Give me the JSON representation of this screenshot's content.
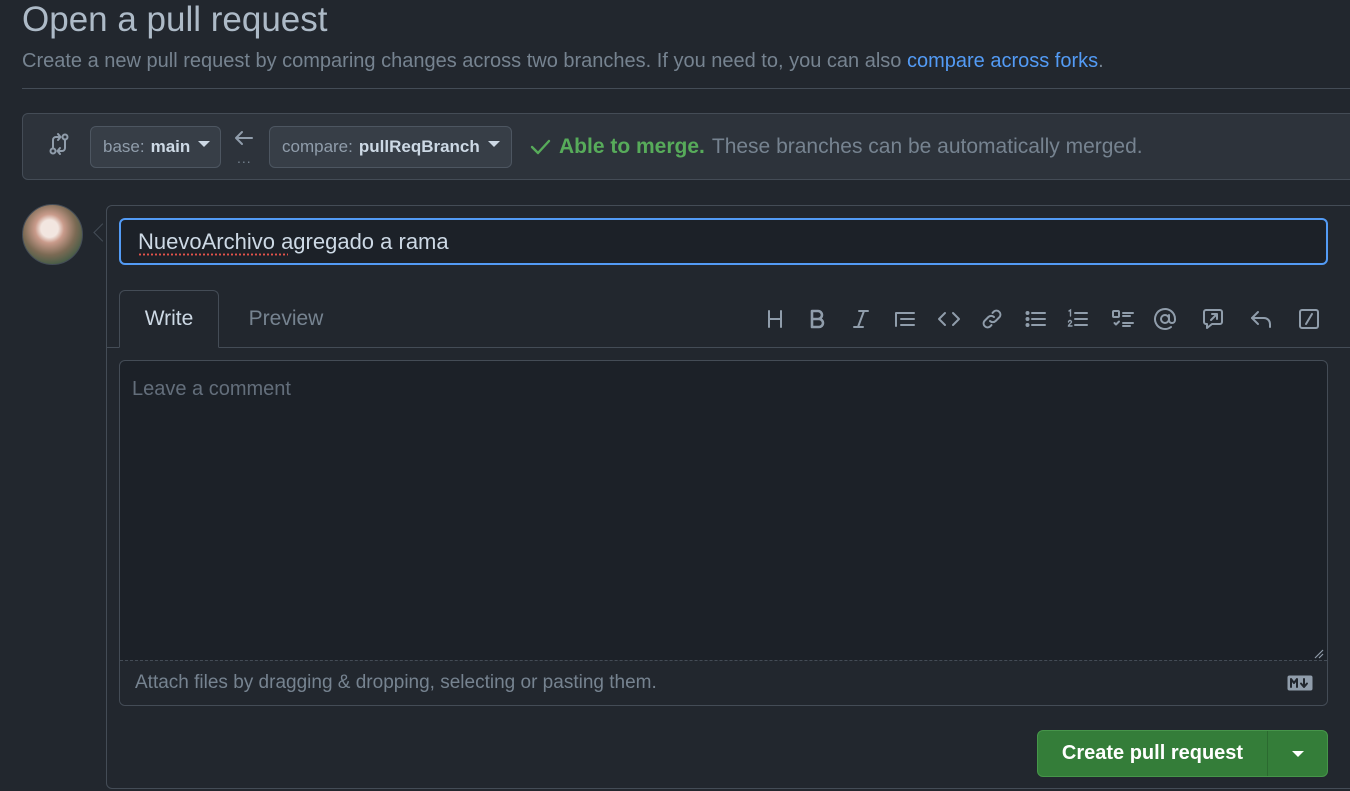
{
  "header": {
    "title": "Open a pull request",
    "subtitle": "Create a new pull request by comparing changes across two branches. If you need to, you can also ",
    "subtitle_link": "compare across forks",
    "subtitle_end": "."
  },
  "compare": {
    "base_label": "base:",
    "base_value": "main",
    "compare_label": "compare:",
    "compare_value": "pullReqBranch",
    "dots": "...",
    "merge_ok": "Able to merge.",
    "merge_msg": "These branches can be automatically merged."
  },
  "form": {
    "title_value": "NuevoArchivo agregado a rama",
    "tabs": [
      {
        "label": "Write",
        "active": true
      },
      {
        "label": "Preview",
        "active": false
      }
    ],
    "toolbar": [
      "heading-icon",
      "bold-icon",
      "italic-icon",
      "quote-icon",
      "code-icon",
      "link-icon",
      "unordered-list-icon",
      "ordered-list-icon",
      "task-list-icon",
      "mention-icon",
      "cross-reference-icon",
      "saved-replies-icon",
      "slash-commands-icon"
    ],
    "comment_placeholder": "Leave a comment",
    "attach_text": "Attach files by dragging & dropping, selecting or pasting them.",
    "create_label": "Create pull request"
  },
  "colors": {
    "background": "#22272e",
    "accent_blue": "#539bf5",
    "success_green": "#57ab5a",
    "button_green": "#347d39"
  }
}
